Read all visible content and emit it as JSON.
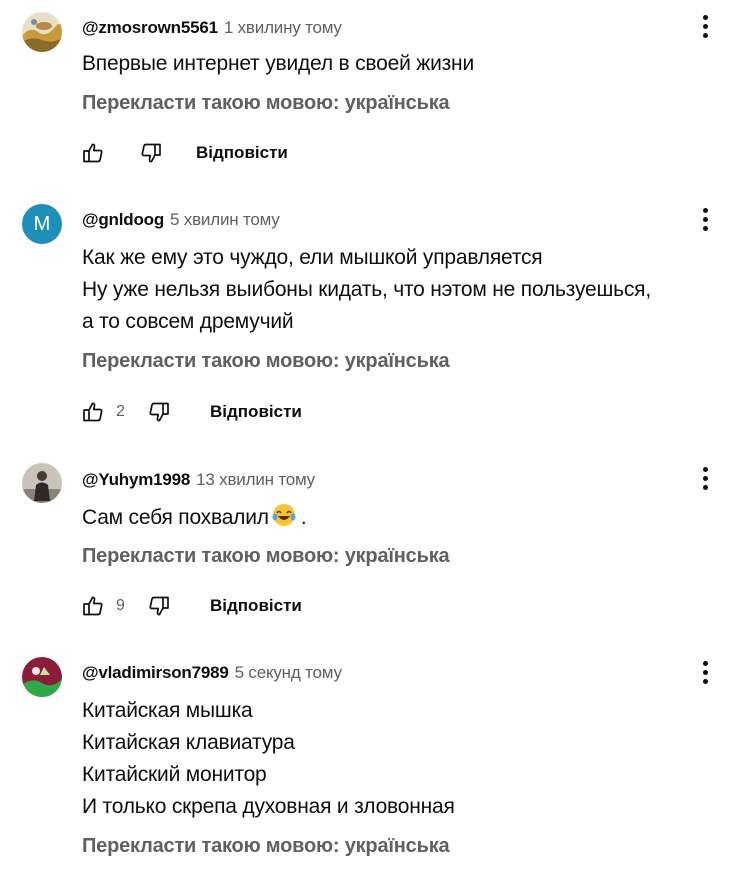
{
  "comments": [
    {
      "author": "@zmosrown5561",
      "time": "1 хвилину тому",
      "lines": [
        "Впервые интернет увидел в своей жизни"
      ],
      "translate": "Перекласти такою мовою: українська",
      "likes": "",
      "reply": "Відповісти",
      "avatar": {
        "type": "image",
        "description": "landscape"
      }
    },
    {
      "author": "@gnldoog",
      "time": "5 хвилин тому",
      "lines": [
        "Как же ему это чуждо, ели мышкой управляется",
        "Ну уже нельзя выибоны кидать, что нэтом не пользуешься,",
        "а то совсем дремучий"
      ],
      "translate": "Перекласти такою мовою: українська",
      "likes": "2",
      "reply": "Відповісти",
      "avatar": {
        "type": "letter",
        "letter": "M",
        "color": "#1e8fb8"
      }
    },
    {
      "author": "@Yuhym1998",
      "time": "13 хвилин тому",
      "lines": [
        "Сам себя похвалил"
      ],
      "line_suffix": ".",
      "translate": "Перекласти такою мовою: українська",
      "likes": "9",
      "reply": "Відповісти",
      "avatar": {
        "type": "image",
        "description": "person"
      }
    },
    {
      "author": "@vladimirson7989",
      "time": "5 секунд тому",
      "lines": [
        "Китайская мышка",
        "Китайская клавиатура",
        "Китайский монитор",
        "И только скрепа духовная и зловонная"
      ],
      "translate": "Перекласти такою мовою: українська",
      "avatar": {
        "type": "image",
        "description": "green-red art"
      }
    }
  ],
  "icons": {
    "like": "thumb-up-icon",
    "dislike": "thumb-down-icon",
    "menu": "more-vert-icon",
    "emoji": "laughing-tears-emoji"
  }
}
